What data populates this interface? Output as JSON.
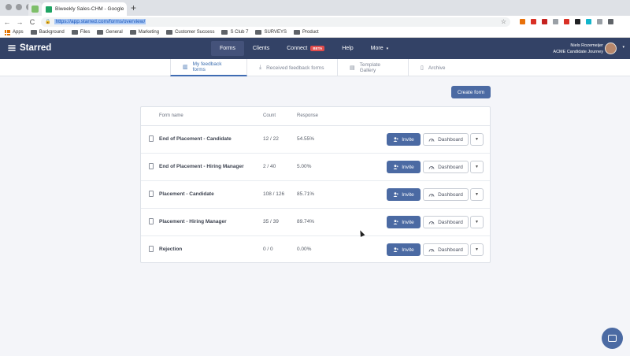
{
  "browser": {
    "tab_title": "Biweekly Sales-CHM - Google",
    "tab_close": "×",
    "new_tab": "+",
    "url": "https://app.starred.com/forms/overview/",
    "back": "←",
    "forward": "→",
    "reload": "C",
    "star": "☆",
    "lock": "🔒",
    "bookmarks": [
      {
        "label": "Apps",
        "icon": "apps-grid-icon"
      },
      {
        "label": "Background",
        "icon": "folder-icon"
      },
      {
        "label": "Files",
        "icon": "folder-icon"
      },
      {
        "label": "General",
        "icon": "folder-icon"
      },
      {
        "label": "Marketing",
        "icon": "folder-icon"
      },
      {
        "label": "Customer Success",
        "icon": "folder-icon"
      },
      {
        "label": "S Club 7",
        "icon": "folder-icon"
      },
      {
        "label": "SURVEYS",
        "icon": "folder-icon"
      },
      {
        "label": "Product",
        "icon": "folder-icon"
      }
    ],
    "extension_colors": [
      "#e8710a",
      "#d93025",
      "#c5221f",
      "#9aa0a6",
      "#d93025",
      "#202124",
      "#12b5cb",
      "#9aa0a6",
      "#5f6368"
    ]
  },
  "app": {
    "logo": "Starred",
    "nav": [
      {
        "label": "Forms",
        "active": true
      },
      {
        "label": "Clients"
      },
      {
        "label": "Connect",
        "badge": "BETA"
      },
      {
        "label": "Help"
      },
      {
        "label": "More",
        "caret": "▾"
      }
    ],
    "user_name": "Niels Rozemeijer",
    "user_org": "ACME Candidate Journey",
    "caret": "▾"
  },
  "subnav": [
    {
      "label": "My feedback forms",
      "icon": "▥",
      "active": true
    },
    {
      "label": "Received feedback forms",
      "icon": "⤓"
    },
    {
      "label": "Template Gallery",
      "icon": "▤"
    },
    {
      "label": "Archive",
      "icon": "▯"
    }
  ],
  "create_form": "Create form",
  "table": {
    "headers": {
      "name": "Form name",
      "count": "Count",
      "response": "Response"
    },
    "rows": [
      {
        "name": "End of Placement - Candidate",
        "count": "12 / 22",
        "response": "54.55%"
      },
      {
        "name": "End of Placement - Hiring Manager",
        "count": "2 / 40",
        "response": "5.00%"
      },
      {
        "name": "Placement - Candidate",
        "count": "108 / 126",
        "response": "85.71%"
      },
      {
        "name": "Placement - Hiring Manager",
        "count": "35 / 39",
        "response": "89.74%"
      },
      {
        "name": "Rejection",
        "count": "0 / 0",
        "response": "0.00%"
      }
    ],
    "invite_label": "Invite",
    "dashboard_label": "Dashboard",
    "more_caret": "▼"
  },
  "colors": {
    "header": "#334266",
    "primary": "#4b6aa3",
    "background": "#f4f5f9",
    "beta": "#e24c4c"
  }
}
